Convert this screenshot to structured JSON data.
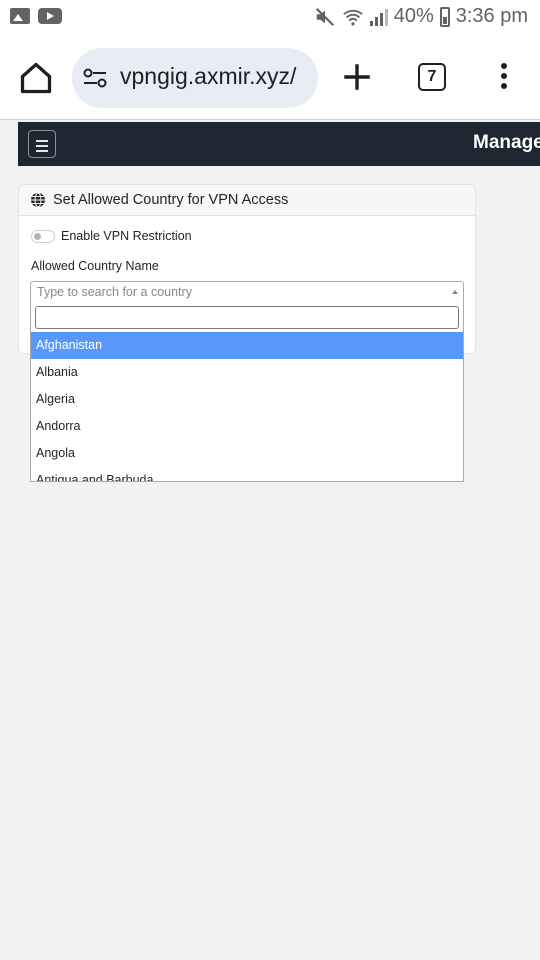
{
  "status_bar": {
    "battery": "40%",
    "time": "3:36 pm",
    "icons": [
      "image-notification-icon",
      "youtube-notification-icon",
      "mute-icon",
      "wifi-icon",
      "signal-icon",
      "battery-icon"
    ]
  },
  "browser": {
    "url": "vpngig.axmir.xyz/",
    "tab_count": "7",
    "icons": [
      "home-icon",
      "site-settings-icon",
      "new-tab-icon",
      "tab-switcher-icon",
      "more-menu-icon"
    ]
  },
  "navbar": {
    "title": "Manage"
  },
  "card": {
    "title": "Set Allowed Country for VPN Access",
    "toggle_label": "Enable VPN Restriction",
    "field_label": "Allowed Country Name",
    "select_placeholder": "Type to search for a country",
    "search_value": ""
  },
  "dropdown": {
    "options": [
      "Afghanistan",
      "Albania",
      "Algeria",
      "Andorra",
      "Angola",
      "Antigua and Barbuda"
    ],
    "highlighted": "Afghanistan"
  },
  "colors": {
    "navbar_bg": "#1e2631",
    "highlight": "#5897fb",
    "page_bg": "#f2f2f2",
    "omnibox_bg": "#e8edf5"
  }
}
